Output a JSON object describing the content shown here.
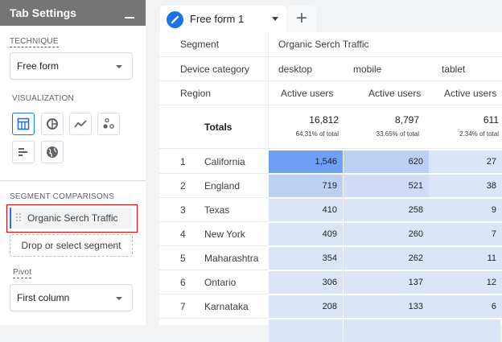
{
  "sidebar": {
    "title": "Tab Settings",
    "technique_label": "TECHNIQUE",
    "technique_value": "Free form",
    "visualization_label": "VISUALIZATION",
    "viz_icons": [
      "table-icon",
      "donut-chart-icon",
      "line-chart-icon",
      "scatter-icon",
      "bar-chart-icon",
      "globe-icon"
    ],
    "segment_label": "SEGMENT COMPARISONS",
    "segment": "Organic Serch Traffic",
    "drop_label": "Drop or select segment",
    "pivot_label": "Pivot",
    "pivot_value": "First column"
  },
  "tabs": {
    "active": "Free form 1",
    "add": "+"
  },
  "table": {
    "segment_label": "Segment",
    "segment_value": "Organic Serch Traffic",
    "device_label": "Device category",
    "devices": [
      "desktop",
      "mobile",
      "tablet"
    ],
    "region_label": "Region",
    "metric": "Active users",
    "totals_label": "Totals",
    "totals": [
      "16,812",
      "8,797",
      "611"
    ],
    "totals_pct": [
      "64.31% of total",
      "33.65% of total",
      "2.34% of total"
    ],
    "rows": [
      {
        "n": "1",
        "region": "California",
        "values": [
          "1,546",
          "620",
          "27"
        ]
      },
      {
        "n": "2",
        "region": "England",
        "values": [
          "719",
          "521",
          "38"
        ]
      },
      {
        "n": "3",
        "region": "Texas",
        "values": [
          "410",
          "258",
          "9"
        ]
      },
      {
        "n": "4",
        "region": "New York",
        "values": [
          "409",
          "260",
          "7"
        ]
      },
      {
        "n": "5",
        "region": "Maharashtra",
        "values": [
          "354",
          "262",
          "11"
        ]
      },
      {
        "n": "6",
        "region": "Ontario",
        "values": [
          "306",
          "137",
          "12"
        ]
      },
      {
        "n": "7",
        "region": "Karnataka",
        "values": [
          "208",
          "133",
          "6"
        ]
      }
    ]
  },
  "colors": {
    "accent": "#1a73e8",
    "heat_high": "#6fa0f5",
    "heat_mid": "#bcd0f4",
    "heat_lowmid": "#d0dcf6",
    "heat_low": "#dce5f8"
  }
}
